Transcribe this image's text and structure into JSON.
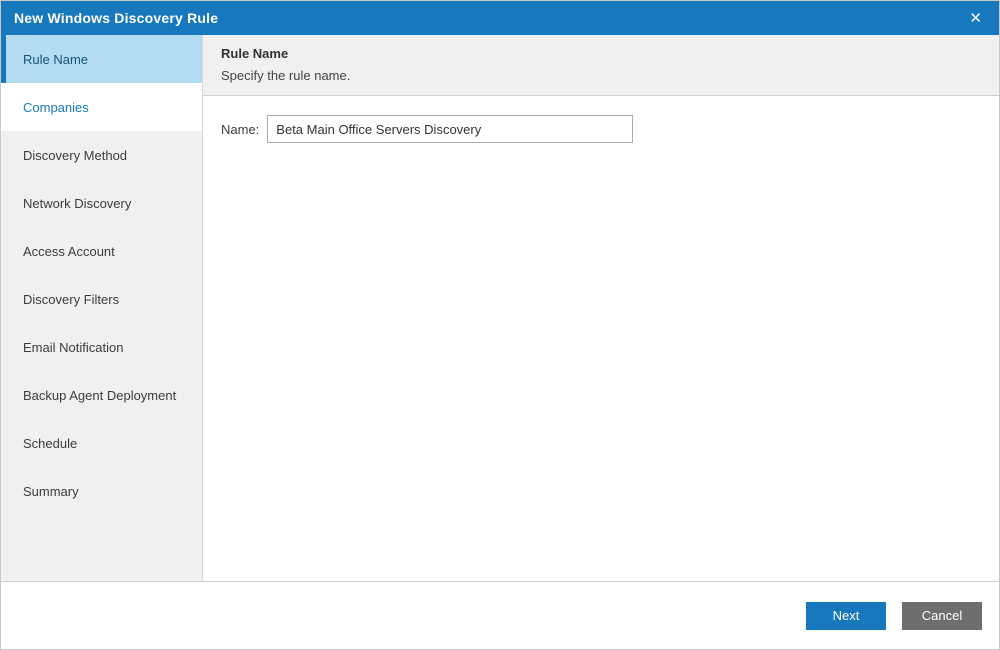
{
  "window": {
    "title": "New Windows Discovery Rule",
    "close_glyph": "✕"
  },
  "sidebar": {
    "items": [
      {
        "label": "Rule Name",
        "state": "active"
      },
      {
        "label": "Companies",
        "state": "visited"
      },
      {
        "label": "Discovery Method",
        "state": "upcoming"
      },
      {
        "label": "Network Discovery",
        "state": "upcoming"
      },
      {
        "label": "Access Account",
        "state": "upcoming"
      },
      {
        "label": "Discovery Filters",
        "state": "upcoming"
      },
      {
        "label": "Email Notification",
        "state": "upcoming"
      },
      {
        "label": "Backup Agent Deployment",
        "state": "upcoming"
      },
      {
        "label": "Schedule",
        "state": "upcoming"
      },
      {
        "label": "Summary",
        "state": "upcoming"
      }
    ]
  },
  "content": {
    "heading": "Rule Name",
    "subtitle": "Specify the rule name.",
    "form": {
      "name_label": "Name:",
      "name_value": "Beta Main Office Servers Discovery"
    }
  },
  "footer": {
    "next_label": "Next",
    "cancel_label": "Cancel"
  },
  "colors": {
    "titlebar": "#1778be",
    "accent": "#1778be",
    "active_step_bg": "#b3dcf2",
    "active_step_text": "#19537c",
    "visited_step_text": "#1778be",
    "cancel_button": "#6e6e6e"
  }
}
